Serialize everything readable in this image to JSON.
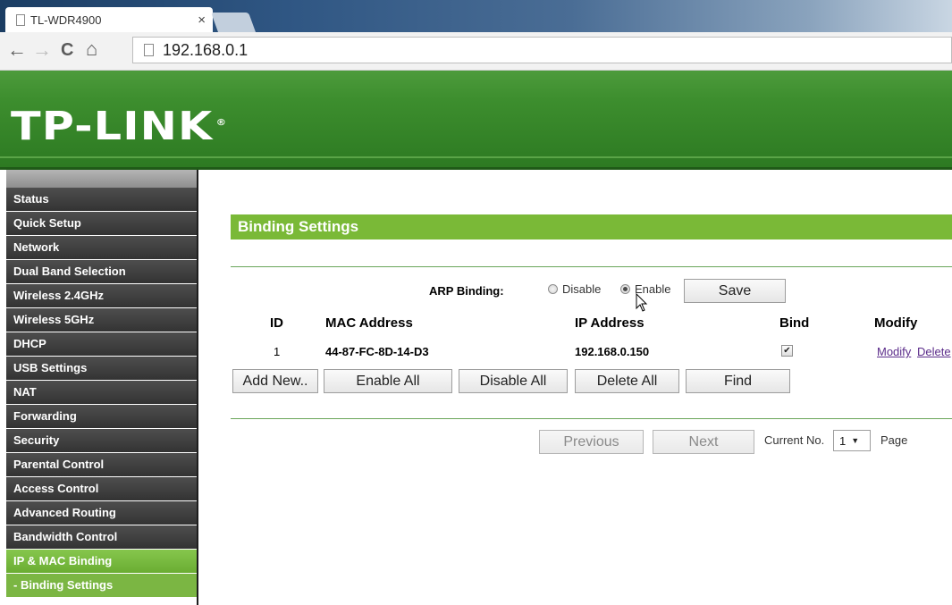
{
  "browser": {
    "tab_title": "TL-WDR4900",
    "tab_close": "×",
    "url": "192.168.0.1",
    "back": "←",
    "forward": "→",
    "reload": "C",
    "home": "⌂"
  },
  "brand": {
    "logo": "TP-LINK",
    "logo_mark": "®"
  },
  "sidebar": {
    "items": [
      {
        "label": "Status"
      },
      {
        "label": "Quick Setup"
      },
      {
        "label": "Network"
      },
      {
        "label": "Dual Band Selection"
      },
      {
        "label": "Wireless 2.4GHz"
      },
      {
        "label": "Wireless 5GHz"
      },
      {
        "label": "DHCP"
      },
      {
        "label": "USB Settings"
      },
      {
        "label": "NAT"
      },
      {
        "label": "Forwarding"
      },
      {
        "label": "Security"
      },
      {
        "label": "Parental Control"
      },
      {
        "label": "Access Control"
      },
      {
        "label": "Advanced Routing"
      },
      {
        "label": "Bandwidth Control"
      },
      {
        "label": "IP & MAC Binding",
        "active": true
      },
      {
        "label": "- Binding Settings",
        "sub": true
      }
    ]
  },
  "main": {
    "section_title": "Binding Settings",
    "arp": {
      "label": "ARP Binding:",
      "disable_label": "Disable",
      "enable_label": "Enable",
      "selected": "Enable",
      "save_label": "Save"
    },
    "table": {
      "headers": [
        "ID",
        "MAC Address",
        "IP Address",
        "Bind",
        "Modify"
      ],
      "rows": [
        {
          "id": "1",
          "mac": "44-87-FC-8D-14-D3",
          "ip": "192.168.0.150",
          "bind": true,
          "modify": "Modify",
          "delete": "Delete"
        }
      ]
    },
    "actions": {
      "add_new": "Add New..",
      "enable_all": "Enable All",
      "disable_all": "Disable All",
      "delete_all": "Delete All",
      "find": "Find"
    },
    "pager": {
      "previous": "Previous",
      "next": "Next",
      "current_label": "Current No.",
      "current_value": "1",
      "page_label": "Page"
    }
  },
  "colors": {
    "brand_green": "#3d8e2e",
    "section_green": "#7ab937",
    "sidebar_dark": "#3a3a3a",
    "sidebar_active": "#6aad32",
    "link_purple": "#5b2c8a"
  }
}
